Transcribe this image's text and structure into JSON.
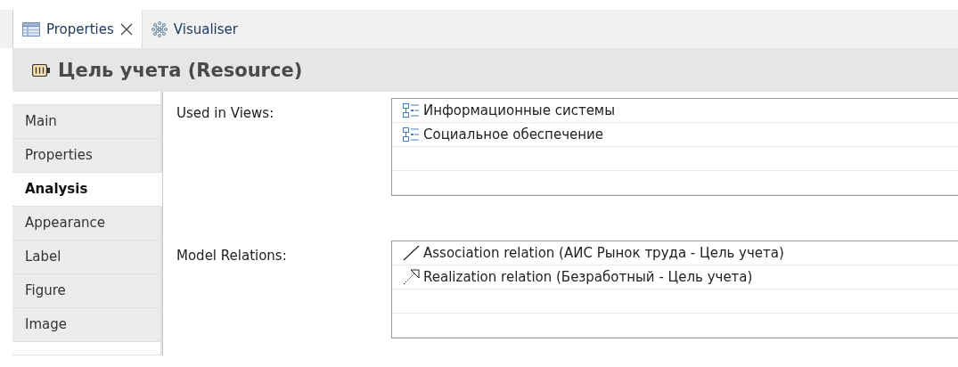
{
  "tabs": [
    {
      "label": "Properties",
      "kind": "table",
      "selected": true,
      "closable": true
    },
    {
      "label": "Visualiser",
      "kind": "visualiser",
      "selected": false,
      "closable": false
    }
  ],
  "header": {
    "title": "Цель учета (Resource)"
  },
  "sidebar": {
    "items": [
      {
        "label": "Main",
        "selected": false
      },
      {
        "label": "Properties",
        "selected": false
      },
      {
        "label": "Analysis",
        "selected": true
      },
      {
        "label": "Appearance",
        "selected": false
      },
      {
        "label": "Label",
        "selected": false
      },
      {
        "label": "Figure",
        "selected": false
      },
      {
        "label": "Image",
        "selected": false
      }
    ]
  },
  "sections": [
    {
      "label": "Used in Views:",
      "rows": [
        {
          "kind": "view",
          "text": "Информационные системы"
        },
        {
          "kind": "view",
          "text": "Социальное обеспечение"
        }
      ]
    },
    {
      "label": "Model Relations:",
      "rows": [
        {
          "kind": "association",
          "text": "Association relation (АИС Рынок труда - Цель учета)"
        },
        {
          "kind": "realization",
          "text": "Realization relation (Безработный - Цель учета)"
        }
      ]
    }
  ]
}
